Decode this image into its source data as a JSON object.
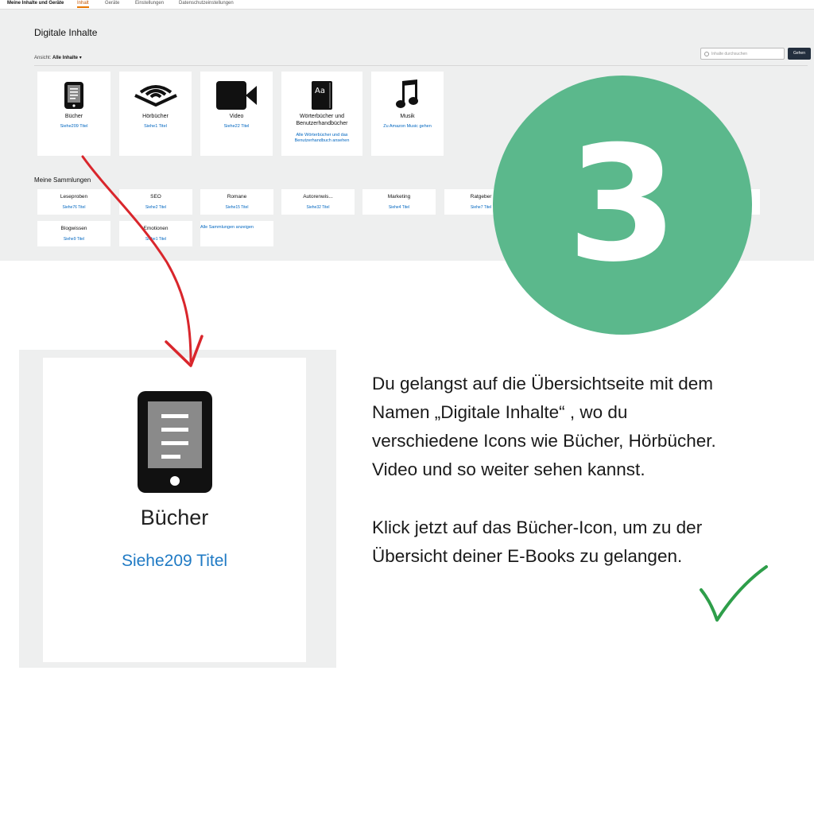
{
  "topbar": {
    "tabs": [
      "Meine Inhalte und Geräte",
      "Inhalt",
      "Geräte",
      "Einstellungen",
      "Datenschutzeinstellungen"
    ]
  },
  "page": {
    "title": "Digitale Inhalte",
    "filter_label": "Ansicht:",
    "filter_value": "Alle Inhalte ▾",
    "search_placeholder": "Inhalte durchsuchen",
    "go_label": "Gehen"
  },
  "content_cards": [
    {
      "name": "Bücher",
      "link": "Siehe209 Titel",
      "icon": "ereader-icon"
    },
    {
      "name": "Hörbücher",
      "link": "Siehe1 Titel",
      "icon": "audible-icon"
    },
    {
      "name": "Video",
      "link": "Siehe22 Titel",
      "icon": "video-camera-icon"
    },
    {
      "name": "Wörterbücher und Benutzerhandbücher",
      "link": "Alle Wörterbücher und das Benutzerhandbuch ansehen",
      "icon": "dictionary-icon"
    },
    {
      "name": "Musik",
      "link": "Zu Amazon Music gehen",
      "icon": "music-note-icon"
    }
  ],
  "collections": {
    "title": "Meine Sammlungen",
    "items": [
      {
        "name": "Leseproben",
        "count": "Siehe76 Titel"
      },
      {
        "name": "SEO",
        "count": "Siehe2 Titel"
      },
      {
        "name": "Romane",
        "count": "Siehe15 Titel"
      },
      {
        "name": "Autorenwis...",
        "count": "Siehe32 Titel"
      },
      {
        "name": "Marketing",
        "count": "Siehe4 Titel"
      },
      {
        "name": "Ratgeber",
        "count": "Siehe7 Titel"
      },
      {
        "name": "Blogwissen",
        "count": "Siehe9 Titel"
      },
      {
        "name": "Emotionen",
        "count": "Siehe1 Titel"
      }
    ],
    "show_all": "Alle Sammlungen anzeigen"
  },
  "badge": {
    "number": "3",
    "color": "#5bb88c"
  },
  "zoom": {
    "name": "Bücher",
    "link": "Siehe209 Titel"
  },
  "explanation": {
    "p1": [
      "Du gelangst auf die Übersichtseite mit dem",
      "Namen „Digitale Inhalte“ , wo du",
      "verschiedene Icons wie Bücher, Hörbücher.",
      "Video und so weiter sehen kannst."
    ],
    "p2": [
      "Klick jetzt auf das Bücher-Icon, um zu der",
      "Übersicht deiner E-Books zu gelangen."
    ]
  },
  "colors": {
    "arrow": "#d9262c",
    "check": "#2e9e4a",
    "link": "#0066c0",
    "accent": "#e77600"
  }
}
